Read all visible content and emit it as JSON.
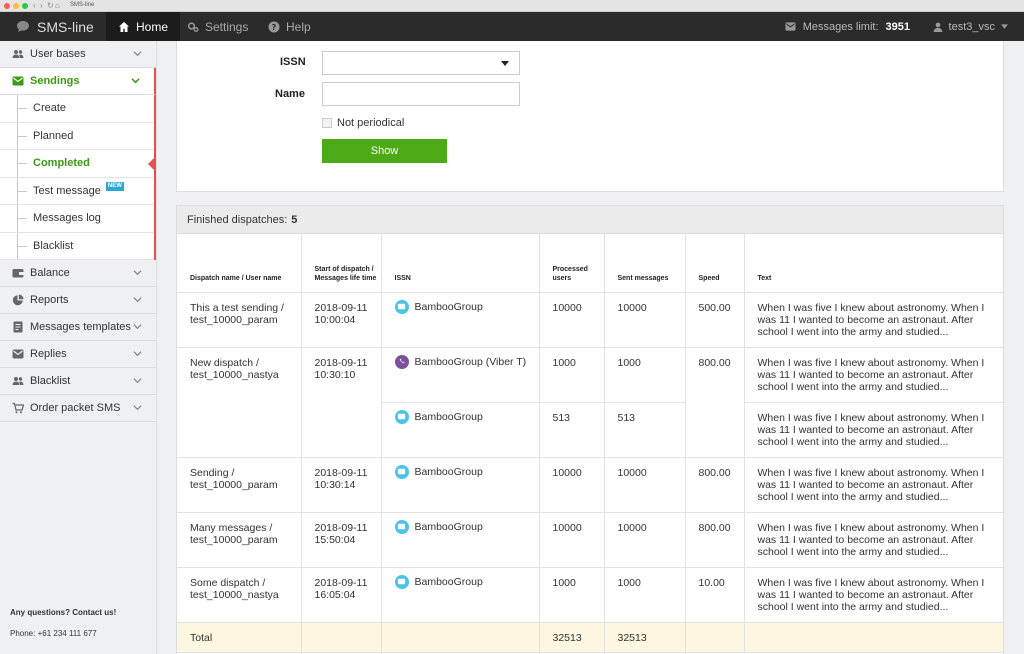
{
  "browser": {
    "url": "SMS-line"
  },
  "topbar": {
    "logo": "SMS-line",
    "nav": [
      {
        "label": "Home",
        "icon": "home-icon",
        "active": true
      },
      {
        "label": "Settings",
        "icon": "gears-icon",
        "active": false
      },
      {
        "label": "Help",
        "icon": "help-icon",
        "active": false
      }
    ],
    "limit_label": "Messages limit:",
    "limit_value": "3951",
    "user": "test3_vsc"
  },
  "sidebar": {
    "items": [
      {
        "label": "User bases",
        "icon": "users-icon"
      },
      {
        "label": "Sendings",
        "icon": "envelope-icon"
      },
      {
        "label": "Balance",
        "icon": "wallet-icon"
      },
      {
        "label": "Reports",
        "icon": "pie-chart-icon"
      },
      {
        "label": "Messages templates",
        "icon": "template-icon"
      },
      {
        "label": "Replies",
        "icon": "reply-icon"
      },
      {
        "label": "Blacklist",
        "icon": "users-icon"
      },
      {
        "label": "Order packet SMS",
        "icon": "cart-icon"
      }
    ],
    "sendings_sub": [
      "Create",
      "Planned",
      "Completed",
      "Test message",
      "Messages log",
      "Blacklist"
    ],
    "new_badge": "NEW",
    "contact_title": "Any questions? Contact us!",
    "phone": "Phone: +61 234 111 677"
  },
  "filter": {
    "issn_label": "ISSN",
    "issn_value": "",
    "name_label": "Name",
    "name_value": "",
    "checkbox_label": "Not periodical",
    "show_label": "Show"
  },
  "results": {
    "title": "Finished dispatches:",
    "count": "5",
    "columns": [
      "Dispatch name / User name",
      "Start of dispatch / Messages life time",
      "ISSN",
      "Processed users",
      "Sent messages",
      "Speed",
      "Text"
    ],
    "text_value": "When I was five I knew about astronomy. When I was 11 I wanted to become an astronaut. After school I went into the army and studied...",
    "rows": [
      {
        "name": "This a test sending / test_10000_param",
        "start": "2018-09-11 10:00:04",
        "issn": "BambooGroup",
        "issn_icon": "sms",
        "processed": "10000",
        "sent": "10000",
        "speed": "500.00"
      },
      {
        "name": "New dispatch / test_10000_nastya",
        "start": "2018-09-11 10:30:10",
        "issn": "BambooGroup (Viber T)",
        "issn_icon": "viber",
        "processed": "1000",
        "sent": "1000",
        "speed": "800.00"
      },
      {
        "issn": "BambooGroup",
        "issn_icon": "sms",
        "processed": "513",
        "sent": "513"
      },
      {
        "name": "Sending / test_10000_param",
        "start": "2018-09-11 10:30:14",
        "issn": "BambooGroup",
        "issn_icon": "sms",
        "processed": "10000",
        "sent": "10000",
        "speed": "800.00"
      },
      {
        "name": "Many messages / test_10000_param",
        "start": "2018-09-11 15:50:04",
        "issn": "BambooGroup",
        "issn_icon": "sms",
        "processed": "10000",
        "sent": "10000",
        "speed": "800.00"
      },
      {
        "name": "Some dispatch / test_10000_nastya",
        "start": "2018-09-11 16:05:04",
        "issn": "BambooGroup",
        "issn_icon": "sms",
        "processed": "1000",
        "sent": "1000",
        "speed": "10.00"
      }
    ],
    "total_label": "Total",
    "total_processed": "32513",
    "total_sent": "32513"
  },
  "colors": {
    "accent_green": "#4caa16",
    "active_red": "#e75152",
    "topbar": "#2b2b2b",
    "sms_icon": "#4ac3e8",
    "viber_icon": "#7b519d"
  }
}
